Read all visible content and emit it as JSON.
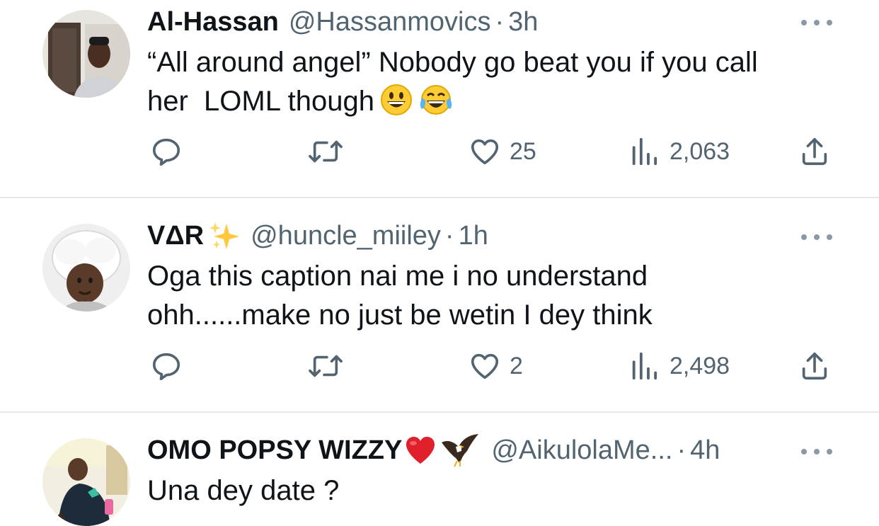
{
  "tweets": [
    {
      "name": "Al-Hassan",
      "badge": "",
      "handle": "@Hassanmovics",
      "separator": "·",
      "time": "3h",
      "text_line1": "“All around angel” Nobody go beat you if you call",
      "text_line2": "her  LOML though",
      "emojis": [
        "grinning-face-icon",
        "tears-of-joy-icon"
      ],
      "likes": "25",
      "views": "2,063"
    },
    {
      "name": "VΔR",
      "badge": "sparkles-icon",
      "handle": "@huncle_miiley",
      "separator": "·",
      "time": "1h",
      "text_line1": "Oga this caption nai me i no understand",
      "text_line2": "ohh......make no just be wetin I dey think",
      "likes": "2",
      "views": "2,498"
    },
    {
      "name": "OMO POPSY WIZZY",
      "badge": "red-heart-icon eagle-icon",
      "handle": "@AikulolaMe...",
      "separator": "·",
      "time": "4h",
      "text_line1": "Una dey date ?"
    }
  ],
  "colors": {
    "text": "#0f1419",
    "secondary": "#536471",
    "divider": "#e4e8eb"
  }
}
